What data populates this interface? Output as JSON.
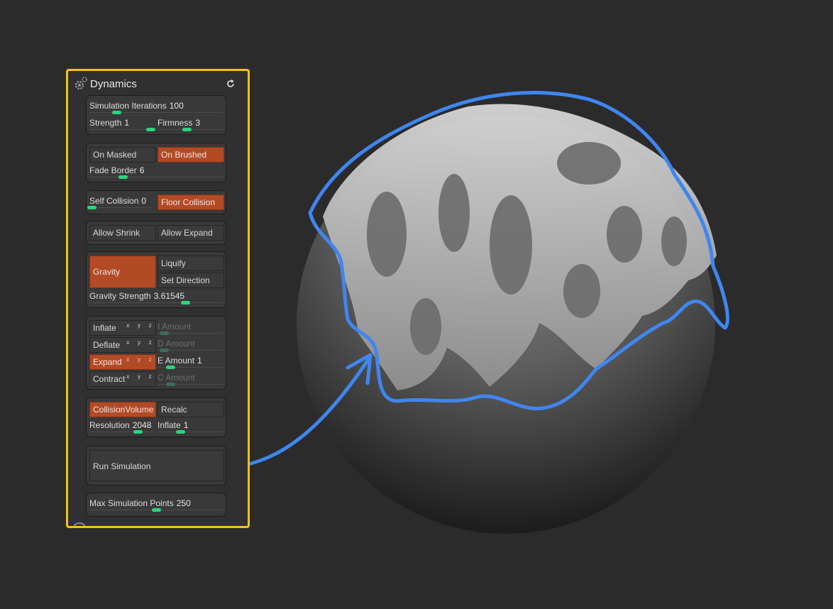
{
  "panel": {
    "title": "Dynamics",
    "gear_icon": "gear-icon",
    "reset_icon": "refresh-icon"
  },
  "sim": {
    "iterations": {
      "label": "Simulation Iterations",
      "value": "100",
      "level": 0.2
    },
    "strength": {
      "label": "Strength",
      "value": "1",
      "level": 0.95
    },
    "firmness": {
      "label": "Firmness",
      "value": "3",
      "level": 0.45
    }
  },
  "mask": {
    "on_masked": "On Masked",
    "on_brushed": "On Brushed",
    "fade_border": {
      "label": "Fade Border",
      "value": "6",
      "level": 0.25
    }
  },
  "collision": {
    "self_collision": {
      "label": "Self Collision",
      "value": "0",
      "level": 0.03
    },
    "floor_collision": "Floor Collision"
  },
  "shrink": {
    "allow_shrink": "Allow Shrink",
    "allow_expand": "Allow Expand"
  },
  "gravity": {
    "gravity": "Gravity",
    "liquify": "Liquify",
    "set_direction": "Set Direction",
    "strength": {
      "label": "Gravity Strength",
      "value": "3.61545",
      "level": 0.72
    }
  },
  "deform": {
    "axis_glyph": "x y z",
    "inflate": "Inflate",
    "deflate": "Deflate",
    "expand": "Expand",
    "contract": "Contract",
    "i_amount": {
      "label": "I Amount",
      "value": "",
      "level": 0.1
    },
    "d_amount": {
      "label": "D Amount",
      "value": "",
      "level": 0.1
    },
    "e_amount": {
      "label": "E Amount",
      "value": "1",
      "level": 0.2
    },
    "c_amount": {
      "label": "C Amount",
      "value": "",
      "level": 0.2
    }
  },
  "volume": {
    "collision_volume": "CollisionVolume",
    "recalc": "Recalc",
    "resolution": {
      "label": "Resolution",
      "value": "2048",
      "level": 0.75
    },
    "inflate": {
      "label": "Inflate",
      "value": "1",
      "level": 0.35
    }
  },
  "run": {
    "label": "Run Simulation"
  },
  "max_points": {
    "label": "Max Simulation Points",
    "value": "250",
    "level": 0.5
  },
  "colors": {
    "panel_border": "#f2c318",
    "active_button": "#b34a26",
    "slider_knob": "#2ad57e",
    "annotation_stroke": "#3f86f0"
  }
}
